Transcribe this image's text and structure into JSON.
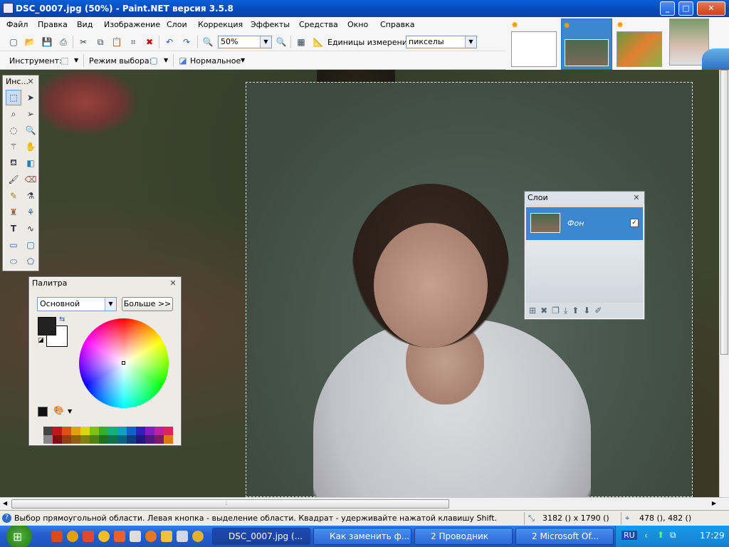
{
  "window": {
    "title": "DSC_0007.jpg (50%) - Paint.NET версия 3.5.8"
  },
  "menu": [
    "Файл",
    "Правка",
    "Вид",
    "Изображение",
    "Слои",
    "Коррекция",
    "Эффекты",
    "Средства",
    "Окно",
    "Справка"
  ],
  "toolbar": {
    "zoom": "50%",
    "units_label": "Единицы измерения:",
    "units_value": "пикселы",
    "tool_label": "Инструмент:",
    "selection_mode_label": "Режим выбора:",
    "blend_mode": "Нормальное"
  },
  "tools_panel": {
    "title": "Инс..."
  },
  "palette_panel": {
    "title": "Палитра",
    "mode": "Основной",
    "more_button": "Больше >>"
  },
  "layers_panel": {
    "title": "Слои",
    "layer_name": "Фон"
  },
  "status": {
    "hint": "Выбор прямоугольной области. Левая кнопка - выделение области. Квадрат - удерживайте нажатой клавишу Shift.",
    "size": "3182 () x 1790 ()",
    "cursor": "478 (), 482 ()"
  },
  "taskbar": {
    "tasks": [
      "DSC_0007.jpg (...",
      "Как заменить ф...",
      "2 Проводник",
      "2 Microsoft Of..."
    ],
    "lang": "RU",
    "clock": "17:29"
  },
  "colors": {
    "titlebar": "#0a5fd8",
    "taskbar": "#245ed0",
    "selection": "#3c88d0"
  }
}
